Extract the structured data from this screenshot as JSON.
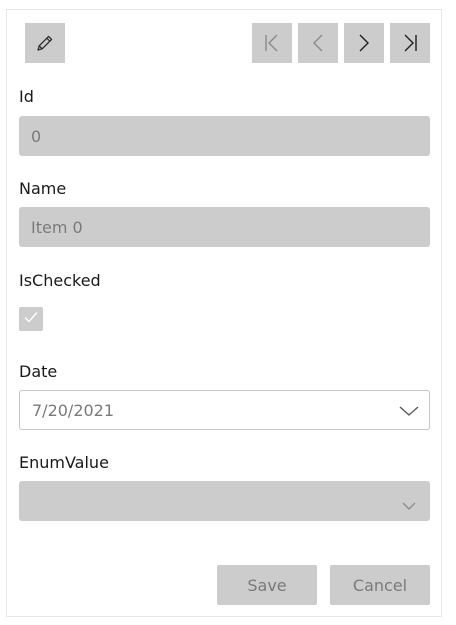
{
  "toolbar": {
    "edit_icon": "pencil-icon",
    "nav_icons": [
      "first-page-icon",
      "previous-icon",
      "next-icon",
      "last-page-icon"
    ]
  },
  "fields": {
    "id": {
      "label": "Id",
      "value": "0"
    },
    "name": {
      "label": "Name",
      "value": "Item 0"
    },
    "is_checked": {
      "label": "IsChecked",
      "checked": true
    },
    "date": {
      "label": "Date",
      "value": "7/20/2021"
    },
    "enum_value": {
      "label": "EnumValue",
      "value": ""
    }
  },
  "actions": {
    "save_label": "Save",
    "cancel_label": "Cancel"
  },
  "colors": {
    "disabled_fill": "#cccccc",
    "disabled_text": "#7a7a7a",
    "label_text": "#1a1a1a",
    "border": "#c6c6c6"
  }
}
